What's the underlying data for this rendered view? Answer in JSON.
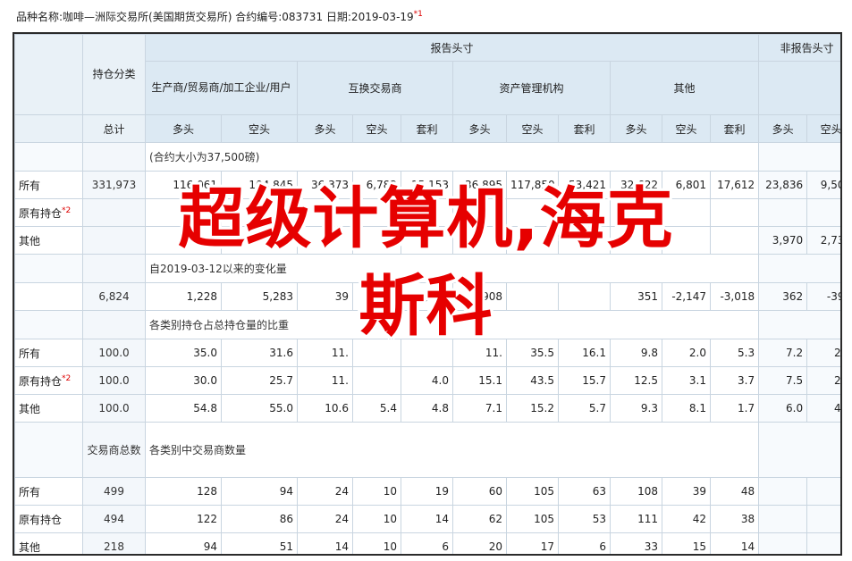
{
  "caption": {
    "text": "品种名称:咖啡—洲际交易所(美国期货交易所)  合约编号:083731  日期:2019-03-19",
    "sup": "*1"
  },
  "headers": {
    "report": "报告头寸",
    "nonreport": "非报告头寸",
    "holding_class": "持仓分类",
    "producer": "生产商/贸易商/加工企业/用户",
    "swap": "互换交易商",
    "managed": "资产管理机构",
    "other": "其他",
    "total": "总计",
    "long": "多头",
    "short": "空头",
    "spread": "套利"
  },
  "sections": {
    "contract_size": "(合约大小为37,500磅)",
    "change": "自2019-03-12以来的变化量",
    "ratio": "各类别持仓占总持仓量的比重",
    "trader_total": "交易商总数",
    "trader_count": "各类别中交易商数量"
  },
  "rows": {
    "positions": [
      {
        "label": "所有",
        "sup": "",
        "values": [
          "331,973",
          "116,061",
          "104,845",
          "36,373",
          "6,782",
          "15,153",
          "36,895",
          "117,850",
          "53,421",
          "32,622",
          "6,801",
          "17,612",
          "23,836",
          "9,509"
        ]
      },
      {
        "label": "原有持仓",
        "sup": "*2",
        "values": [
          "",
          "",
          "",
          "",
          "",
          "",
          "",
          "",
          "",
          "",
          "",
          "",
          "",
          ""
        ]
      },
      {
        "label": "其他",
        "sup": "",
        "values": [
          "",
          "",
          "",
          "",
          "",
          "",
          "",
          "",
          "",
          "",
          "",
          "",
          "3,970",
          "2,733"
        ]
      }
    ],
    "changes": [
      "6,824",
      "1,228",
      "5,283",
      "39",
      "132",
      "1,864",
      "908",
      "",
      "",
      "351",
      "-2,147",
      "-3,018",
      "362",
      "-396"
    ],
    "ratios": [
      {
        "label": "所有",
        "sup": "",
        "values": [
          "100.0",
          "35.0",
          "31.6",
          "11.",
          "",
          "",
          "11.",
          "35.5",
          "16.1",
          "9.8",
          "2.0",
          "5.3",
          "7.2",
          "2.9"
        ]
      },
      {
        "label": "原有持仓",
        "sup": "*2",
        "values": [
          "100.0",
          "30.0",
          "25.7",
          "11.",
          "",
          "4.0",
          "15.1",
          "43.5",
          "15.7",
          "12.5",
          "3.1",
          "3.7",
          "7.5",
          "2.6"
        ]
      },
      {
        "label": "其他",
        "sup": "",
        "values": [
          "100.0",
          "54.8",
          "55.0",
          "10.6",
          "5.4",
          "4.8",
          "7.1",
          "15.2",
          "5.7",
          "9.3",
          "8.1",
          "1.7",
          "6.0",
          "4.0"
        ]
      }
    ],
    "traders": [
      {
        "label": "所有",
        "sup": "",
        "values": [
          "499",
          "128",
          "94",
          "24",
          "10",
          "19",
          "60",
          "105",
          "63",
          "108",
          "39",
          "48",
          "",
          ""
        ]
      },
      {
        "label": "原有持仓",
        "sup": "",
        "values": [
          "494",
          "122",
          "86",
          "24",
          "10",
          "14",
          "62",
          "105",
          "53",
          "111",
          "42",
          "38",
          "",
          ""
        ]
      },
      {
        "label": "其他",
        "sup": "",
        "values": [
          "218",
          "94",
          "51",
          "14",
          "10",
          "6",
          "20",
          "17",
          "6",
          "33",
          "15",
          "14",
          "",
          ""
        ]
      }
    ]
  },
  "overlay": {
    "line1": "超级计算机,海克",
    "line2": "斯科"
  }
}
